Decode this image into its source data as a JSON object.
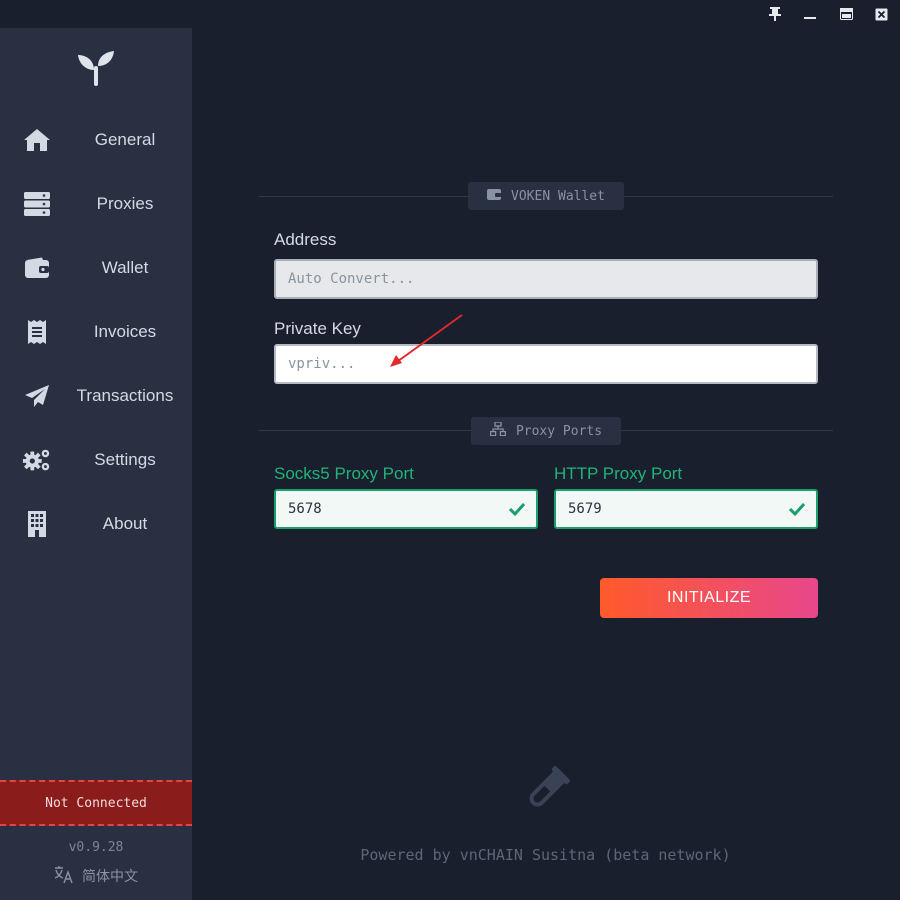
{
  "window": {
    "controls": [
      "pin-icon",
      "minimize-icon",
      "maximize-icon",
      "close-icon"
    ]
  },
  "sidebar": {
    "items": [
      {
        "label": "General",
        "icon": "home-icon"
      },
      {
        "label": "Proxies",
        "icon": "server-icon"
      },
      {
        "label": "Wallet",
        "icon": "wallet-icon"
      },
      {
        "label": "Invoices",
        "icon": "receipt-icon"
      },
      {
        "label": "Transactions",
        "icon": "paper-plane-icon"
      },
      {
        "label": "Settings",
        "icon": "gears-icon"
      },
      {
        "label": "About",
        "icon": "building-icon"
      }
    ],
    "status": "Not Connected",
    "version": "v0.9.28",
    "language": "简体中文"
  },
  "wallet_section": {
    "title": "VOKEN Wallet",
    "address_label": "Address",
    "address_placeholder": "Auto Convert...",
    "private_key_label": "Private Key",
    "private_key_placeholder": "vpriv..."
  },
  "proxy_section": {
    "title": "Proxy Ports",
    "socks5_label": "Socks5 Proxy Port",
    "socks5_value": "5678",
    "http_label": "HTTP Proxy Port",
    "http_value": "5679"
  },
  "actions": {
    "initialize": "INITIALIZE"
  },
  "footer": {
    "text": "Powered by vnCHAIN Susitna (beta network)"
  },
  "colors": {
    "background": "#1a1f2e",
    "sidebar": "#283042",
    "status_bg": "#8b1c1c",
    "valid": "#1fb37a",
    "button_start": "#ff5a2a",
    "button_end": "#e8478c"
  }
}
